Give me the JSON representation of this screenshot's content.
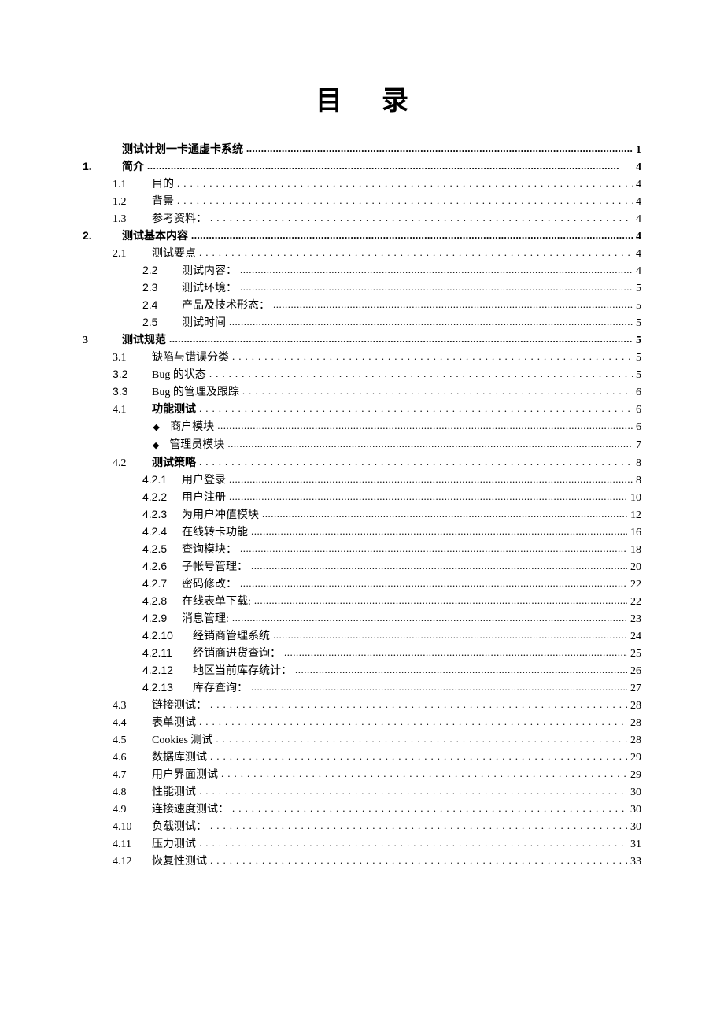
{
  "title": "目录",
  "leader_dots": "................................................................................................................................................................",
  "toc": [
    {
      "indent": 0,
      "num": "",
      "label": "测试计划一卡通虚卡系统",
      "page": "1",
      "bold": true,
      "leader": "dense"
    },
    {
      "indent": 0,
      "num": "1.",
      "label": "简介",
      "page": "4",
      "bold": true,
      "leader": "dense",
      "numClass": "sans bold"
    },
    {
      "indent": 1,
      "num": "1.1",
      "label": "目的",
      "page": "4",
      "leader": "wide"
    },
    {
      "indent": 1,
      "num": "1.2",
      "label": "背景",
      "page": "4",
      "leader": "wide"
    },
    {
      "indent": 1,
      "num": "1.3",
      "label": "参考资料：",
      "page": "4",
      "leader": "wide"
    },
    {
      "indent": 0,
      "num": "2.",
      "label": "测试基本内容",
      "page": "4",
      "bold": true,
      "leader": "dense",
      "numClass": "sans bold"
    },
    {
      "indent": 1,
      "num": "2.1",
      "label": "测试要点",
      "page": "4",
      "leader": "wide"
    },
    {
      "indent": 2,
      "num": "2.2",
      "label": "测试内容：",
      "page": "4",
      "leader": "dense",
      "numClass": "sans"
    },
    {
      "indent": 2,
      "num": "2.3",
      "label": "测试环境：",
      "page": "5",
      "leader": "dense",
      "numClass": "sans"
    },
    {
      "indent": 2,
      "num": "2.4",
      "label": "产品及技术形态：",
      "page": "5",
      "leader": "dense",
      "numClass": "sans"
    },
    {
      "indent": 2,
      "num": "2.5",
      "label": "测试时间",
      "page": "5",
      "leader": "dense",
      "numClass": "sans"
    },
    {
      "indent": 0,
      "num": "3",
      "label": "测试规范",
      "page": "5",
      "bold": true,
      "leader": "dense"
    },
    {
      "indent": 1,
      "num": "3.1",
      "label": "缺陷与错误分类",
      "page": "5",
      "leader": "wide"
    },
    {
      "indent": 1,
      "num": "3.2",
      "label": "Bug 的状态",
      "page": "5",
      "leader": "wide",
      "numClass": "sans"
    },
    {
      "indent": 1,
      "num": "3.3",
      "label": "Bug 的管理及跟踪",
      "page": "6",
      "leader": "wide",
      "numClass": "sans"
    },
    {
      "indent": 1,
      "num": "4.1",
      "label": "功能测试",
      "page": "6",
      "leader": "wide",
      "labelBold": true
    },
    {
      "indent": 2,
      "bullet": true,
      "label": "商户模块",
      "page": "6",
      "leader": "dense"
    },
    {
      "indent": 2,
      "bullet": true,
      "label": "管理员模块",
      "page": "7",
      "leader": "dense"
    },
    {
      "indent": 1,
      "num": "4.2",
      "label": "测试策略",
      "page": "8",
      "leader": "wide",
      "labelBold": true
    },
    {
      "indent": 3,
      "num": "4.2.1",
      "label": "用户登录",
      "page": "8",
      "leader": "dense",
      "numClass": "sans"
    },
    {
      "indent": 3,
      "num": "4.2.2",
      "label": "用户注册",
      "page": "10",
      "leader": "dense",
      "numClass": "sans"
    },
    {
      "indent": 3,
      "num": "4.2.3",
      "label": "为用户冲值模块",
      "page": "12",
      "leader": "dense",
      "numClass": "sans"
    },
    {
      "indent": 3,
      "num": "4.2.4",
      "label": "在线转卡功能",
      "page": "16",
      "leader": "dense",
      "numClass": "sans"
    },
    {
      "indent": 3,
      "num": "4.2.5",
      "label": "查询模块：",
      "page": "18",
      "leader": "dense",
      "numClass": "sans"
    },
    {
      "indent": 3,
      "num": "4.2.6",
      "label": "子帐号管理：",
      "page": "20",
      "leader": "dense",
      "numClass": "sans"
    },
    {
      "indent": 3,
      "num": "4.2.7",
      "label": "密码修改：",
      "page": "22",
      "leader": "dense",
      "numClass": "sans"
    },
    {
      "indent": 3,
      "num": "4.2.8",
      "label": "在线表单下载:",
      "page": "22",
      "leader": "dense",
      "numClass": "sans"
    },
    {
      "indent": 3,
      "num": "4.2.9",
      "label": "消息管理:",
      "page": "23",
      "leader": "dense",
      "numClass": "sans"
    },
    {
      "indent": 3,
      "num": "4.2.10",
      "label": "经销商管理系统",
      "page": "24",
      "leader": "dense",
      "numClass": "sans",
      "numWide": true
    },
    {
      "indent": 3,
      "num": "4.2.11",
      "label": "经销商进货查询：",
      "page": "25",
      "leader": "dense",
      "numClass": "sans",
      "numWide": true
    },
    {
      "indent": 3,
      "num": "4.2.12",
      "label": "地区当前库存统计：",
      "page": "26",
      "leader": "dense",
      "numClass": "sans",
      "numWide": true
    },
    {
      "indent": 3,
      "num": "4.2.13",
      "label": "库存查询：",
      "page": "27",
      "leader": "dense",
      "numClass": "sans",
      "numWide": true
    },
    {
      "indent": 1,
      "num": "4.3",
      "label": "链接测试：",
      "page": "28",
      "leader": "wide"
    },
    {
      "indent": 1,
      "num": "4.4",
      "label": "表单测试",
      "page": "28",
      "leader": "wide"
    },
    {
      "indent": 1,
      "num": "4.5",
      "label": "Cookies 测试",
      "page": "28",
      "leader": "wide"
    },
    {
      "indent": 1,
      "num": "4.6",
      "label": "数据库测试",
      "page": "29",
      "leader": "wide"
    },
    {
      "indent": 1,
      "num": "4.7",
      "label": "用户界面测试",
      "page": "29",
      "leader": "wide"
    },
    {
      "indent": 1,
      "num": "4.8",
      "label": "性能测试",
      "page": "30",
      "leader": "wide"
    },
    {
      "indent": 1,
      "num": "4.9",
      "label": "连接速度测试：",
      "page": "30",
      "leader": "wide"
    },
    {
      "indent": 1,
      "num": "4.10",
      "label": "负载测试：",
      "page": "30",
      "leader": "wide"
    },
    {
      "indent": 1,
      "num": "4.11",
      "label": "压力测试",
      "page": "31",
      "leader": "wide"
    },
    {
      "indent": 1,
      "num": "4.12",
      "label": "恢复性测试",
      "page": "33",
      "leader": "wide"
    }
  ]
}
